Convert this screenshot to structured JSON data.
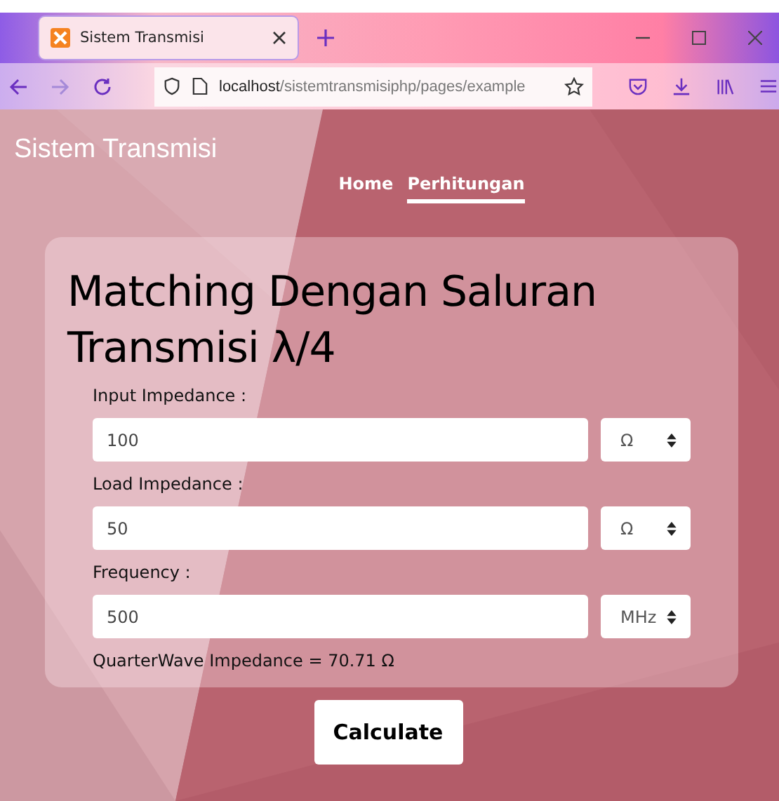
{
  "browser": {
    "tab": {
      "title": "Sistem Transmisi",
      "selected": true
    },
    "url": {
      "host": "localhost",
      "path": "/sistemtransmisiphp/pages/example"
    }
  },
  "site": {
    "title": "Sistem Transmisi",
    "nav": [
      {
        "label": "Home",
        "selected": false
      },
      {
        "label": "Perhitungan",
        "selected": true
      }
    ]
  },
  "card": {
    "heading": "Matching Dengan Saluran Transmisi λ/4",
    "fields": [
      {
        "label": "Input Impedance :",
        "value": "100",
        "unit": "Ω"
      },
      {
        "label": "Load Impedance :",
        "value": "50",
        "unit": "Ω"
      },
      {
        "label": "Frequency :",
        "value": "500",
        "unit": "MHz"
      }
    ],
    "result": "QuarterWave Impedance = 70.71 Ω"
  },
  "button": "Calculate"
}
